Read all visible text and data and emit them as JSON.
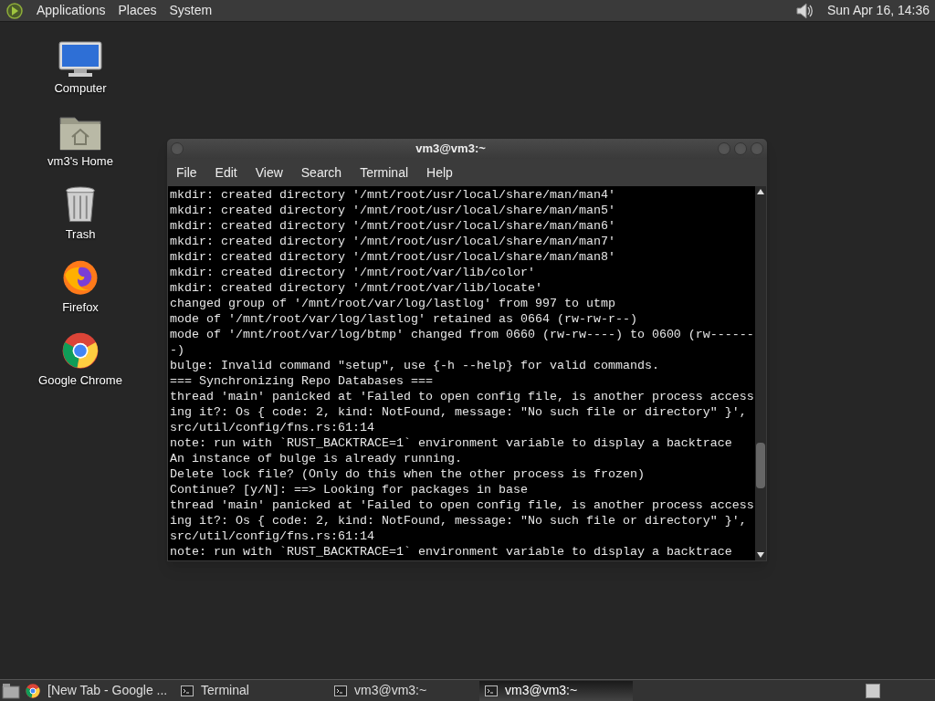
{
  "top_panel": {
    "menus": [
      "Applications",
      "Places",
      "System"
    ],
    "clock": "Sun Apr 16, 14:36"
  },
  "desktop_icons": [
    {
      "label": "Computer",
      "kind": "computer"
    },
    {
      "label": "vm3's Home",
      "kind": "home"
    },
    {
      "label": "Trash",
      "kind": "trash"
    },
    {
      "label": "Firefox",
      "kind": "firefox"
    },
    {
      "label": "Google Chrome",
      "kind": "chrome"
    }
  ],
  "window": {
    "title": "vm3@vm3:~",
    "menus": [
      "File",
      "Edit",
      "View",
      "Search",
      "Terminal",
      "Help"
    ],
    "lines": [
      "mkdir: created directory '/mnt/root/usr/local/share/man/man4'",
      "mkdir: created directory '/mnt/root/usr/local/share/man/man5'",
      "mkdir: created directory '/mnt/root/usr/local/share/man/man6'",
      "mkdir: created directory '/mnt/root/usr/local/share/man/man7'",
      "mkdir: created directory '/mnt/root/usr/local/share/man/man8'",
      "mkdir: created directory '/mnt/root/var/lib/color'",
      "mkdir: created directory '/mnt/root/var/lib/locate'",
      "changed group of '/mnt/root/var/log/lastlog' from 997 to utmp",
      "mode of '/mnt/root/var/log/lastlog' retained as 0664 (rw-rw-r--)",
      "mode of '/mnt/root/var/log/btmp' changed from 0660 (rw-rw----) to 0600 (rw------",
      "-)",
      "bulge: Invalid command \"setup\", use {-h --help} for valid commands.",
      "=== Synchronizing Repo Databases ===",
      "thread 'main' panicked at 'Failed to open config file, is another process access",
      "ing it?: Os { code: 2, kind: NotFound, message: \"No such file or directory\" }',",
      "src/util/config/fns.rs:61:14",
      "note: run with `RUST_BACKTRACE=1` environment variable to display a backtrace",
      "An instance of bulge is already running.",
      "Delete lock file? (Only do this when the other process is frozen)",
      "Continue? [y/N]: ==> Looking for packages in base",
      "thread 'main' panicked at 'Failed to open config file, is another process access",
      "ing it?: Os { code: 2, kind: NotFound, message: \"No such file or directory\" }',",
      "src/util/config/fns.rs:61:14",
      "note: run with `RUST_BACKTRACE=1` environment variable to display a backtrace"
    ]
  },
  "taskbar": {
    "tasks": [
      {
        "label": "[New Tab - Google ...",
        "kind": "chrome",
        "selected": false
      },
      {
        "label": "Terminal",
        "kind": "terminal",
        "selected": false
      },
      {
        "label": "vm3@vm3:~",
        "kind": "terminal",
        "selected": false
      },
      {
        "label": "vm3@vm3:~",
        "kind": "terminal",
        "selected": true
      }
    ]
  }
}
